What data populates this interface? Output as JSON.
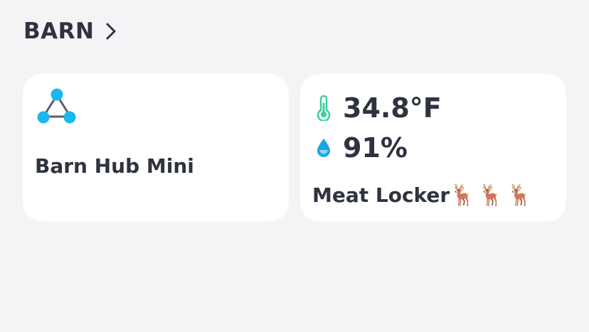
{
  "section": {
    "title": "BARN"
  },
  "devices": {
    "hub": {
      "name": "Barn Hub Mini",
      "icon": "hub-triangle-icon"
    },
    "sensor": {
      "temperature": "34.8°F",
      "humidity": "91%",
      "name": "Meat Locker",
      "name_emoji": "🦌🦌🦌",
      "temperature_icon": "thermometer-icon",
      "humidity_icon": "water-drop-icon"
    }
  },
  "colors": {
    "background": "#f4f4f7",
    "card": "#ffffff",
    "text": "#2f3340",
    "hub_accent": "#1bb7ee",
    "temperature_accent": "#3ecf9d",
    "humidity_accent": "#1aa7e8"
  }
}
